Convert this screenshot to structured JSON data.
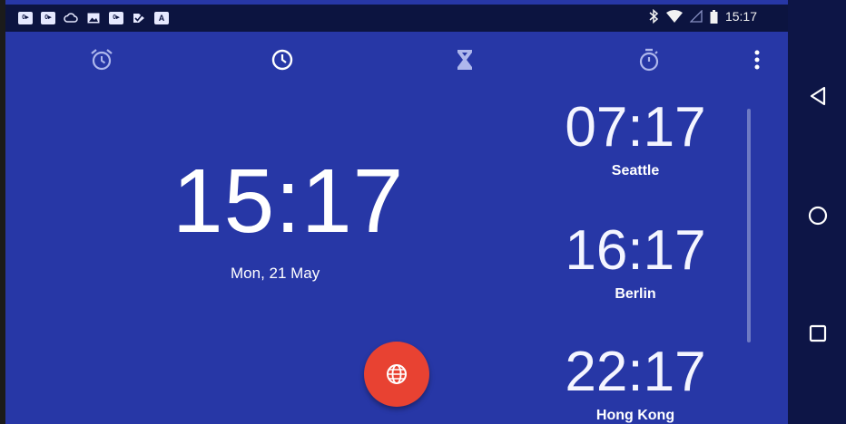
{
  "status_bar": {
    "time": "15:17",
    "notification_icons": [
      "outlook-icon",
      "outlook-icon",
      "cloud-icon",
      "image-icon",
      "outlook-icon",
      "check-tag-icon",
      "a-box-icon"
    ]
  },
  "tabs": [
    {
      "name": "alarm",
      "icon": "alarm-icon",
      "selected": false
    },
    {
      "name": "clock",
      "icon": "clock-icon",
      "selected": true
    },
    {
      "name": "timer",
      "icon": "hourglass-icon",
      "selected": false
    },
    {
      "name": "stopwatch",
      "icon": "stopwatch-icon",
      "selected": false
    }
  ],
  "main_clock": {
    "time": "15:17",
    "date": "Mon, 21 May"
  },
  "world_clocks": [
    {
      "time": "07:17",
      "city": "Seattle"
    },
    {
      "time": "16:17",
      "city": "Berlin"
    },
    {
      "time": "22:17",
      "city": "Hong Kong"
    }
  ],
  "fab": {
    "icon": "globe-icon"
  },
  "nav": {
    "buttons": [
      "back",
      "home",
      "recents"
    ]
  },
  "colors": {
    "background": "#2737a6",
    "status_bar": "#0c1440",
    "fab": "#e84232"
  }
}
